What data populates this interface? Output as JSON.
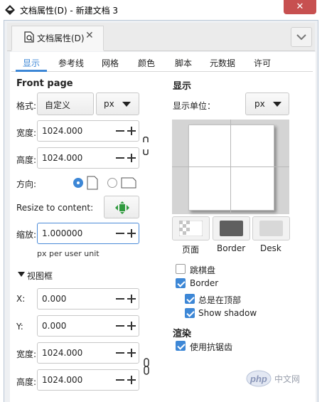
{
  "window": {
    "title": "文档属性(D) - 新建文档 3",
    "close_glyph": "✕"
  },
  "dock": {
    "tab_label": "文档属性(D)",
    "tab_close_glyph": "✕"
  },
  "tabs": [
    {
      "label": "显示",
      "active": true
    },
    {
      "label": "参考线",
      "active": false
    },
    {
      "label": "网格",
      "active": false
    },
    {
      "label": "颜色",
      "active": false
    },
    {
      "label": "脚本",
      "active": false
    },
    {
      "label": "元数据",
      "active": false
    },
    {
      "label": "许可",
      "active": false
    }
  ],
  "front_page": {
    "heading": "Front page",
    "format_label": "格式:",
    "format_value": "自定义",
    "unit_value": "px",
    "width_label": "宽度:",
    "width_value": "1024.000",
    "height_label": "高度:",
    "height_value": "1024.000",
    "orientation_label": "方向:",
    "resize_label": "Resize to content:",
    "scale_label": "缩放:",
    "scale_value": "1.000000",
    "scale_unit": "px per user unit"
  },
  "viewbox": {
    "heading": "视图框",
    "x_label": "X:",
    "x_value": "0.000",
    "y_label": "Y:",
    "y_value": "0.000",
    "width_label": "宽度:",
    "width_value": "1024.000",
    "height_label": "高度:",
    "height_value": "1024.000"
  },
  "display": {
    "heading": "显示",
    "unit_label": "显示单位：",
    "unit_value": "px",
    "swatches": [
      {
        "label": "页面"
      },
      {
        "label": "Border",
        "color": "#5f5f5f"
      },
      {
        "label": "Desk",
        "color": "#d8d8d8"
      }
    ],
    "checkerboard_label": "跳棋盘",
    "checkerboard_checked": false,
    "border_label": "Border",
    "border_checked": true,
    "always_top_label": "总是在顶部",
    "always_top_checked": true,
    "shadow_label": "Show shadow",
    "shadow_checked": true
  },
  "render": {
    "heading": "渲染",
    "antialias_label": "使用抗锯齿",
    "antialias_checked": true
  },
  "watermark": {
    "text": "php",
    "site": "中文网"
  },
  "colors": {
    "accent": "#3d87d6",
    "close": "#c75050"
  }
}
